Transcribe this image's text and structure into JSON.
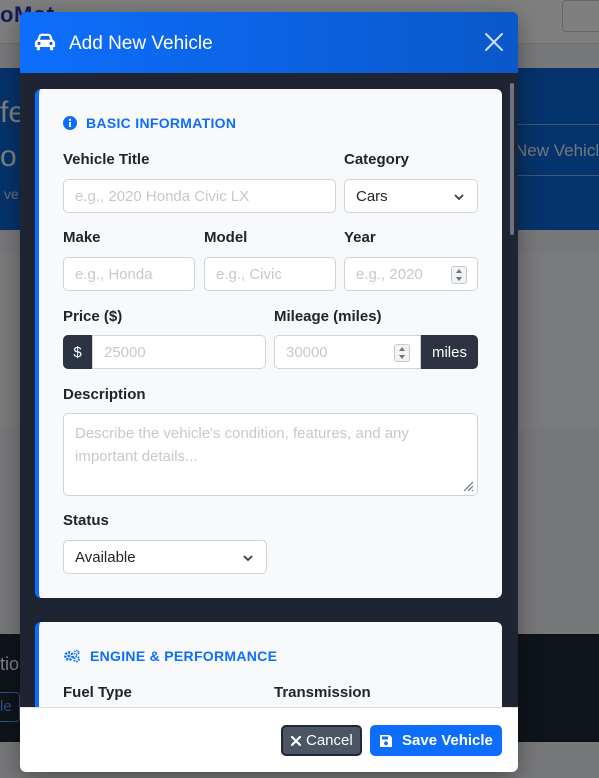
{
  "background": {
    "logo_text": "oMot",
    "hero_title_1": "fe",
    "hero_title_2": "o",
    "hero_sub": "ve",
    "hero_button": "New Vehicl",
    "footer_text": "tio",
    "footer_link": "le"
  },
  "modal": {
    "title": "Add New Vehicle",
    "header_icon": "car-icon",
    "close_icon": "close-icon"
  },
  "basic": {
    "heading": "BASIC INFORMATION",
    "icon": "info-circle-icon",
    "vehicle_title": {
      "label": "Vehicle Title",
      "placeholder": "e.g., 2020 Honda Civic LX"
    },
    "category": {
      "label": "Category",
      "value": "Cars"
    },
    "make": {
      "label": "Make",
      "placeholder": "e.g., Honda"
    },
    "model": {
      "label": "Model",
      "placeholder": "e.g., Civic"
    },
    "year": {
      "label": "Year",
      "placeholder": "e.g., 2020"
    },
    "price": {
      "label": "Price ($)",
      "prefix": "$",
      "placeholder": "25000"
    },
    "mileage": {
      "label": "Mileage (miles)",
      "placeholder": "30000",
      "suffix": "miles"
    },
    "description": {
      "label": "Description",
      "placeholder": "Describe the vehicle's condition, features, and any important details..."
    },
    "status": {
      "label": "Status",
      "value": "Available"
    }
  },
  "engine": {
    "heading": "ENGINE & PERFORMANCE",
    "icon": "gears-icon",
    "fuel_type": {
      "label": "Fuel Type"
    },
    "transmission": {
      "label": "Transmission"
    }
  },
  "footer": {
    "cancel_label": "Cancel",
    "save_label": "Save Vehicle"
  },
  "colors": {
    "primary": "#0d6efd",
    "modal_bg": "#1f2433",
    "card_bg": "#f8f9fb",
    "addon_bg": "#2c3444"
  }
}
